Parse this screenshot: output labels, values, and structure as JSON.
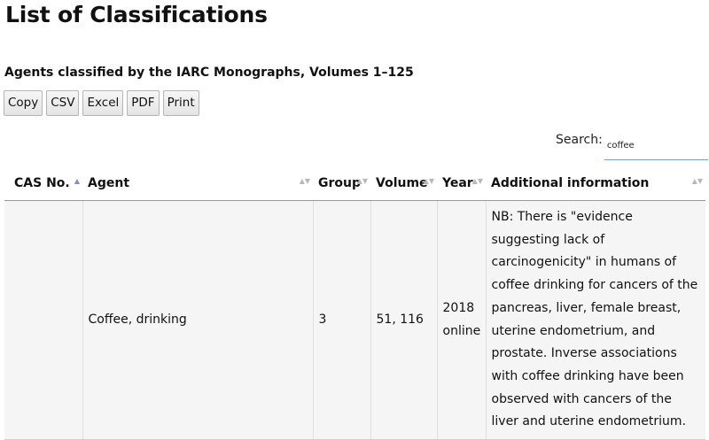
{
  "page": {
    "title": "List of Classifications",
    "subtitle": "Agents classified by the IARC Monographs, Volumes 1–125"
  },
  "toolbar": {
    "copy_label": "Copy",
    "csv_label": "CSV",
    "excel_label": "Excel",
    "pdf_label": "PDF",
    "print_label": "Print"
  },
  "search": {
    "label": "Search:",
    "value": "coffee"
  },
  "table": {
    "headers": {
      "cas": "CAS No.",
      "agent": "Agent",
      "group": "Group",
      "volume": "Volume",
      "year": "Year",
      "info": "Additional information"
    },
    "sort_icons": {
      "active": "▲",
      "inactive": "▲▼"
    },
    "rows": [
      {
        "cas": "",
        "agent": "Coffee, drinking",
        "group": "3",
        "volume": "51, 116",
        "year": "2018 online",
        "info": "NB: There is \"evidence suggesting lack of carcinogenicity\" in humans of coffee drinking for cancers of the pancreas, liver, female breast, uterine endometrium, and prostate. Inverse associations with coffee drinking have been observed with cancers of the liver and uterine endometrium."
      }
    ]
  }
}
